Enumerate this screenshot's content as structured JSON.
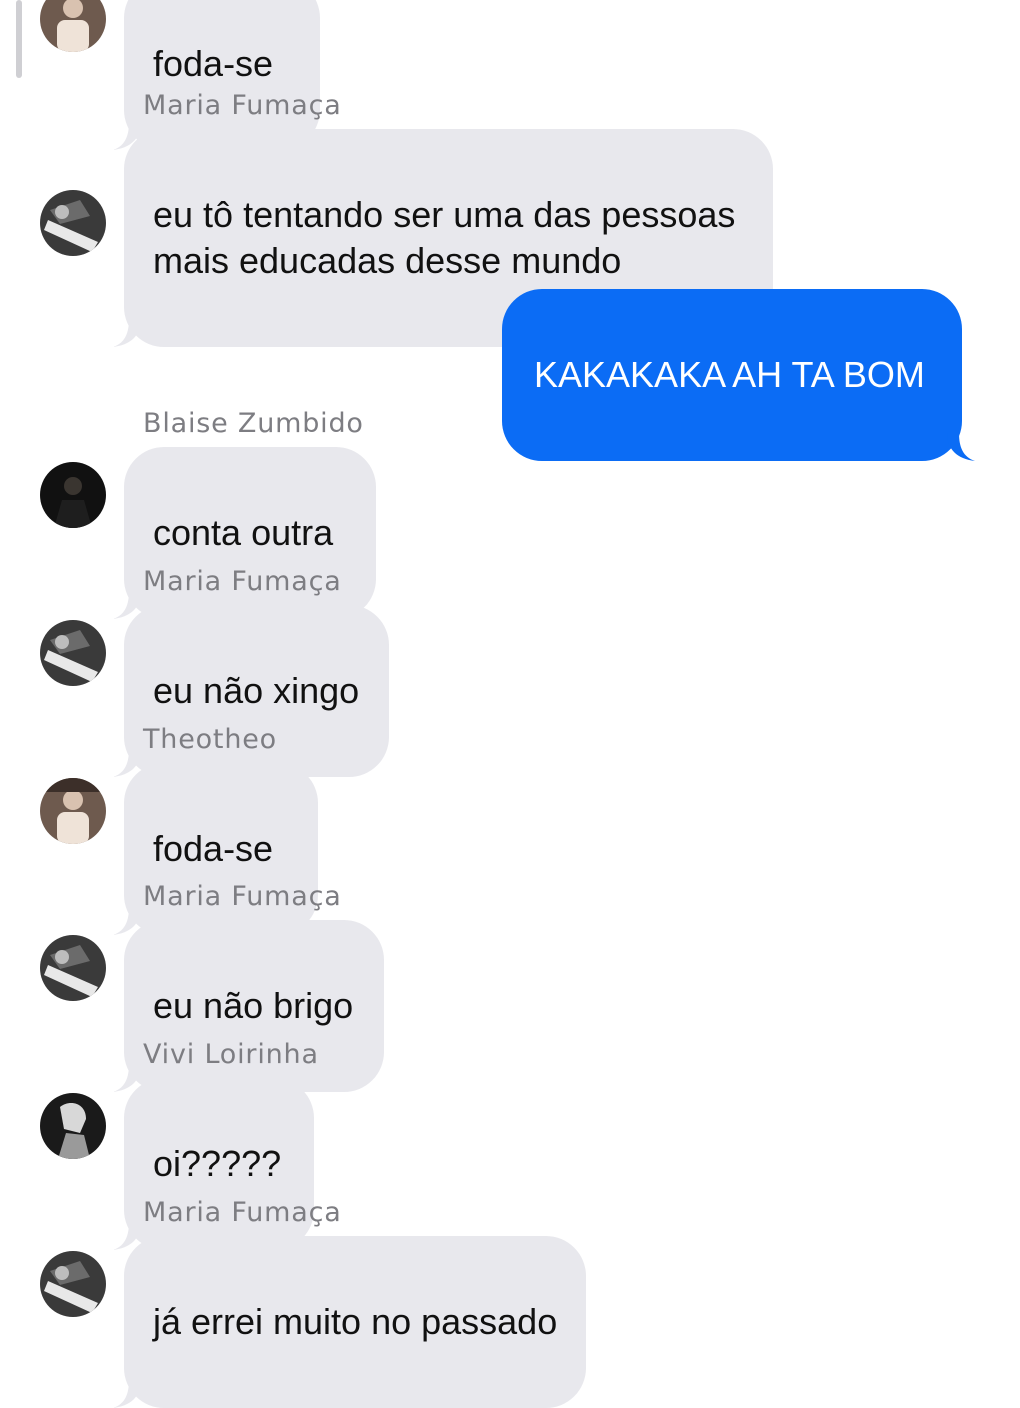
{
  "messages": [
    {
      "sender": "",
      "text": "foda-se",
      "avatar": "theotheo"
    },
    {
      "sender": "Maria Fumaça",
      "text": "eu tô tentando ser uma das pessoas\nmais educadas desse mundo",
      "avatar": "maria"
    },
    {
      "sender": "",
      "text": "KAKAKAKA AH TA BOM",
      "outgoing": true
    },
    {
      "sender": "Blaise Zumbido",
      "text": "conta outra",
      "avatar": "blaise"
    },
    {
      "sender": "Maria Fumaça",
      "text": "eu não xingo",
      "avatar": "maria"
    },
    {
      "sender": "Theotheo",
      "text": "foda-se",
      "avatar": "theotheo"
    },
    {
      "sender": "Maria Fumaça",
      "text": "eu não brigo",
      "avatar": "maria"
    },
    {
      "sender": "Vivi Loirinha",
      "text": "oi?????",
      "avatar": "vivi"
    },
    {
      "sender": "Maria Fumaça",
      "text": "já errei muito no passado",
      "avatar": "maria"
    }
  ],
  "colors": {
    "incoming_bubble": "#e8e8ed",
    "outgoing_bubble": "#0b6cf5",
    "sender_name": "#7d7d82"
  }
}
